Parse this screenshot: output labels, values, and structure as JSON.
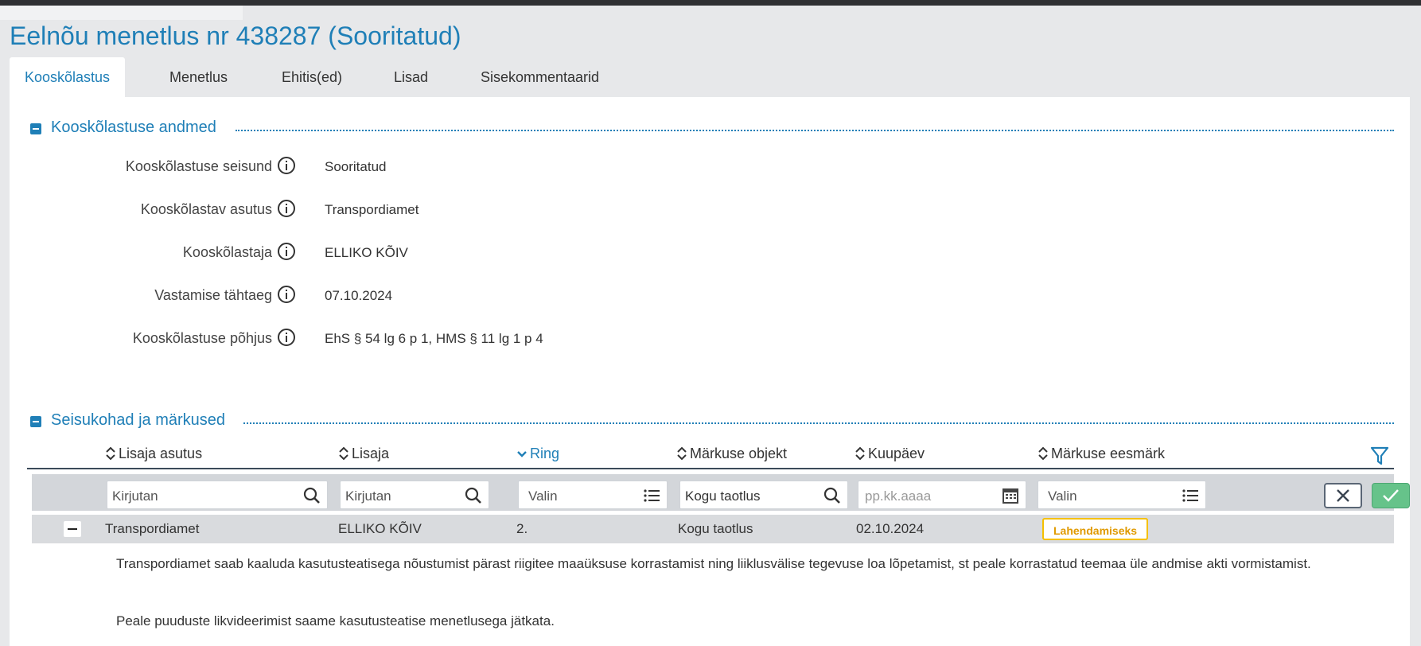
{
  "page": {
    "title": "Eelnõu menetlus nr 438287 (Sooritatud)"
  },
  "tabs": [
    {
      "label": "Kooskõlastus",
      "active": true
    },
    {
      "label": "Menetlus",
      "active": false
    },
    {
      "label": "Ehitis(ed)",
      "active": false
    },
    {
      "label": "Lisad",
      "active": false
    },
    {
      "label": "Sisekommentaarid",
      "active": false
    }
  ],
  "section1": {
    "title": "Kooskõlastuse andmed",
    "fields": [
      {
        "label": "Kooskõlastuse seisund",
        "value": "Sooritatud"
      },
      {
        "label": "Kooskõlastav asutus",
        "value": "Transpordiamet"
      },
      {
        "label": "Kooskõlastaja",
        "value": "ELLIKO KÕIV"
      },
      {
        "label": "Vastamise tähtaeg",
        "value": "07.10.2024"
      },
      {
        "label": "Kooskõlastuse põhjus",
        "value": "EhS § 54 lg 6 p 1, HMS § 11 lg 1 p 4"
      }
    ]
  },
  "section2": {
    "title": "Seisukohad ja märkused",
    "columns": [
      "Lisaja asutus",
      "Lisaja",
      "Ring",
      "Märkuse objekt",
      "Kuupäev",
      "Märkuse eesmärk"
    ],
    "filters": [
      {
        "placeholder": "Kirjutan",
        "icon": "search-icon"
      },
      {
        "placeholder": "Kirjutan",
        "icon": "search-icon"
      },
      {
        "placeholder": "Valin",
        "icon": "list-icon"
      },
      {
        "value": "Kogu taotlus",
        "icon": "search-icon"
      },
      {
        "placeholder": "pp.kk.aaaa",
        "icon": "calendar-icon"
      },
      {
        "placeholder": "Valin",
        "icon": "list-icon"
      }
    ],
    "rows": [
      {
        "asutus": "Transpordiamet",
        "lisaja": "ELLIKO KÕIV",
        "ring": "2.",
        "objekt": "Kogu taotlus",
        "kuupaev": "02.10.2024",
        "eesmark": "Lahendamiseks",
        "comment_p1": "Transpordiamet saab kaaluda kasutusteatisega nõustumist pärast riigitee maaüksuse korrastamist ning liiklusvälise tegevuse loa lõpetamist, st peale korrastatud teemaa üle andmise akti vormistamist.",
        "comment_p2": "Peale puuduste likvideerimist saame kasutusteatise menetlusega jätkata."
      }
    ]
  },
  "colors": {
    "accent": "#1f7fb7",
    "badge_border": "#f5c000",
    "badge_text": "#e09a00",
    "apply": "#66c38a"
  }
}
